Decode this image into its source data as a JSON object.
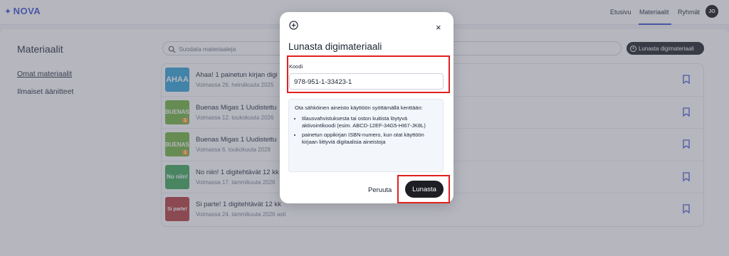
{
  "header": {
    "logo": "NOVA",
    "nav": [
      "Etusivu",
      "Materiaalit",
      "Ryhmät"
    ],
    "avatar_initials": "JO"
  },
  "sidebar": {
    "title": "Materiaalit",
    "links": [
      "Omat materiaalit",
      "Ilmaiset äänitteet"
    ]
  },
  "search": {
    "placeholder": "Suodata materiaaleja"
  },
  "redeem_button": "Lunasta digimateriaali",
  "materials": [
    {
      "title": "Ahaa! 1 painetun kirjan digi",
      "valid": "Voimassa 26. heinäkuuta 2025",
      "thumb_text": "AHAA",
      "thumb_color": "#2ea3d8"
    },
    {
      "title": "Buenas Migas 1 Uudistettu",
      "valid": "Voimassa 12. toukokuuta 2026",
      "thumb_text": "BUENAS",
      "thumb_color": "#6fb33c"
    },
    {
      "title": "Buenas Migas 1 Uudistettu",
      "valid": "Voimassa 6. toukokuuta 2028",
      "thumb_text": "BUENAS",
      "thumb_color": "#6fb33c"
    },
    {
      "title": "No niin! 1 digitehtävät 12 kk",
      "valid": "Voimassa 17. tammikuuta 2026",
      "thumb_text": "No niin!",
      "thumb_color": "#3aa655"
    },
    {
      "title": "Si parte! 1 digitehtävät 12 kk",
      "valid": "Voimassa 24. tammikuuta 2026 asti",
      "thumb_text": "Si parte!",
      "thumb_color": "#b23a3a"
    }
  ],
  "modal": {
    "title": "Lunasta digimateriaali",
    "code_label": "Koodi",
    "code_value": "978-951-1-33423-1",
    "info_intro": "Ota sähköinen aineisto käyttöön syöttämällä kenttään:",
    "info_items": [
      "tilausvahvistuksesta tai oston kuitista löytyvä aktivointikoodi (esim. ABCD-12EF-34G5-HI67-JK8L)",
      "painetun oppikirjan ISBN-numero, kun otat käyttöön kirjaan liittyviä digitaalisia aineistoja"
    ],
    "cancel_label": "Peruuta",
    "submit_label": "Lunasta"
  },
  "colors": {
    "accent": "#3d4fd6",
    "highlight": "#e02020",
    "button_dark": "#1d1f24"
  }
}
